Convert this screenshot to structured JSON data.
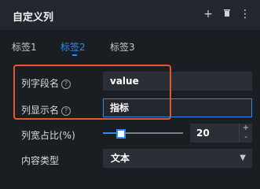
{
  "header": {
    "title": "自定义列",
    "icons": [
      "plus-icon",
      "trash-icon",
      "more-icon"
    ]
  },
  "tabs": [
    {
      "label": "标签1",
      "active": false
    },
    {
      "label": "标签2",
      "active": true
    },
    {
      "label": "标签3",
      "active": false
    }
  ],
  "fields": {
    "column_field_label": "列字段名",
    "column_field_value": "value",
    "column_display_label": "列显示名",
    "column_display_value": "指标",
    "column_width_label": "列宽占比(%)",
    "column_width_value": "20",
    "content_type_label": "内容类型",
    "content_type_value": "文本"
  },
  "help_glyph": "?",
  "stepper": {
    "up": "+",
    "down": "-"
  },
  "colors": {
    "accent": "#2d8cf0",
    "highlight": "#e2572e",
    "background": "#1a1e23"
  },
  "slider": {
    "percent": 20
  }
}
